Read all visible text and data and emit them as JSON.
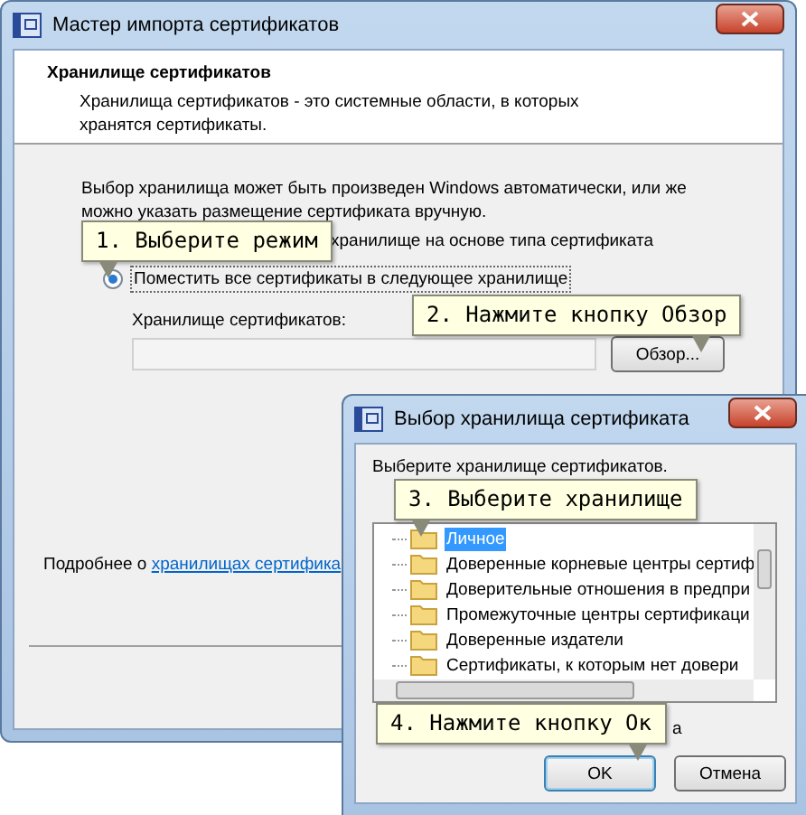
{
  "main_window": {
    "title": "Мастер импорта сертификатов",
    "header": {
      "title": "Хранилище сертификатов",
      "description": "Хранилища сертификатов - это системные области, в которых хранятся сертификаты."
    },
    "intro": "Выбор хранилища может быть произведен Windows автоматически, или же можно указать размещение сертификата вручную.",
    "auto_option_label": "хранилище на основе типа сертификата",
    "manual_option": {
      "label": "Поместить все сертификаты в следующее хранилище",
      "selected": true
    },
    "store_label": "Хранилище сертификатов:",
    "browse_button": "Обзор...",
    "more_info": {
      "text": "Подробнее о",
      "link": "хранилищах сертифика"
    }
  },
  "dialog": {
    "title": "Выбор хранилища сертификата",
    "prompt": "Выберите хранилище сертификатов.",
    "tree_items": [
      {
        "label": "Личное",
        "selected": true
      },
      {
        "label": "Доверенные корневые центры сертиф",
        "selected": false
      },
      {
        "label": "Доверительные отношения в предпри",
        "selected": false
      },
      {
        "label": "Промежуточные центры сертификаци",
        "selected": false
      },
      {
        "label": "Доверенные издатели",
        "selected": false
      },
      {
        "label": "Сертификаты, к которым нет довери",
        "selected": false
      }
    ],
    "checkbox_label": "а",
    "buttons": [
      {
        "label": "OK",
        "default": true
      },
      {
        "label": "Отмена",
        "default": false
      }
    ]
  },
  "callouts": [
    {
      "text": "1. Выберите режим"
    },
    {
      "text": "2. Нажмите кнопку Обзор"
    },
    {
      "text": "3. Выберите хранилище"
    },
    {
      "text": "4. Нажмите кнопку Ок"
    }
  ]
}
